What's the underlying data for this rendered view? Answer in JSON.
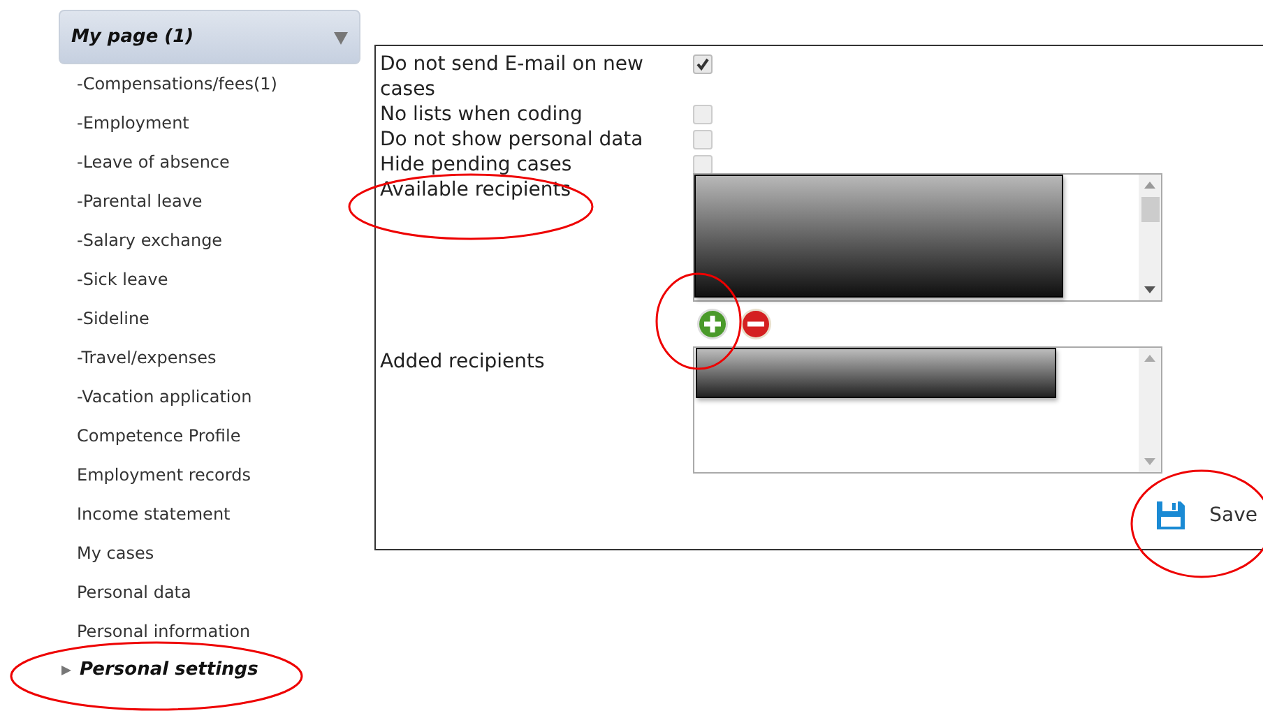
{
  "sidebar": {
    "header": "My page (1)",
    "items": [
      {
        "label": "-Compensations/fees(1)",
        "selected": false
      },
      {
        "label": "-Employment",
        "selected": false
      },
      {
        "label": "-Leave of absence",
        "selected": false
      },
      {
        "label": "-Parental leave",
        "selected": false
      },
      {
        "label": "-Salary exchange",
        "selected": false
      },
      {
        "label": "-Sick leave",
        "selected": false
      },
      {
        "label": "-Sideline",
        "selected": false
      },
      {
        "label": "-Travel/expenses",
        "selected": false
      },
      {
        "label": "-Vacation application",
        "selected": false
      },
      {
        "label": "Competence Profile",
        "selected": false
      },
      {
        "label": "Employment records",
        "selected": false
      },
      {
        "label": "Income statement",
        "selected": false
      },
      {
        "label": "My cases",
        "selected": false
      },
      {
        "label": "Personal data",
        "selected": false
      },
      {
        "label": "Personal information",
        "selected": false
      },
      {
        "label": "Personal settings",
        "selected": true
      }
    ]
  },
  "settings": [
    {
      "label": "Do not send E-mail on new cases",
      "checked": true
    },
    {
      "label": "No lists when coding",
      "checked": false
    },
    {
      "label": "Do not show personal data",
      "checked": false
    },
    {
      "label": "Hide pending cases",
      "checked": false
    }
  ],
  "available_recipients": {
    "label": "Available recipients"
  },
  "added_recipients": {
    "label": "Added recipients"
  },
  "save_button": {
    "label": "Save"
  }
}
